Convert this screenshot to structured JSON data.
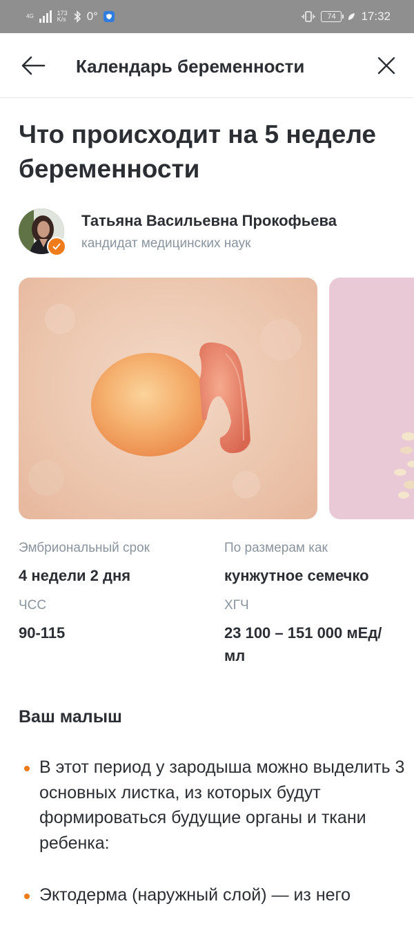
{
  "status_bar": {
    "network_type": "4G",
    "speed_value": "173",
    "speed_unit": "K/s",
    "temperature": "0°",
    "battery": "74",
    "time": "17:32"
  },
  "header": {
    "title": "Календарь беременности",
    "back_icon": "arrow-left-icon",
    "close_icon": "close-icon"
  },
  "article": {
    "title": "Что происходит на 5 неделе беременности",
    "author": {
      "name": "Татьяна Васильевна Прокофьева",
      "role": "кандидат медицинских наук"
    }
  },
  "stats": [
    {
      "label": "Эмбриональный срок",
      "value": "4 недели 2 дня"
    },
    {
      "label": "По размерам как",
      "value": "кунжутное семечко"
    },
    {
      "label": "ЧСС",
      "value": "90-115"
    },
    {
      "label": "ХГЧ",
      "value": "23 100 – 151 000 мЕд/мл"
    }
  ],
  "section": {
    "title": "Ваш малыш",
    "bullets": [
      "В этот период у зародыша можно выделить 3 основных листка, из которых будут формироваться будущие органы и ткани ребенка:",
      "Эктодерма (наружный слой) — из него"
    ]
  },
  "colors": {
    "accent": "#f07b1a",
    "status_bar": "#8f8f8f",
    "text_primary": "#2b2f33",
    "text_secondary": "#8a949e"
  }
}
